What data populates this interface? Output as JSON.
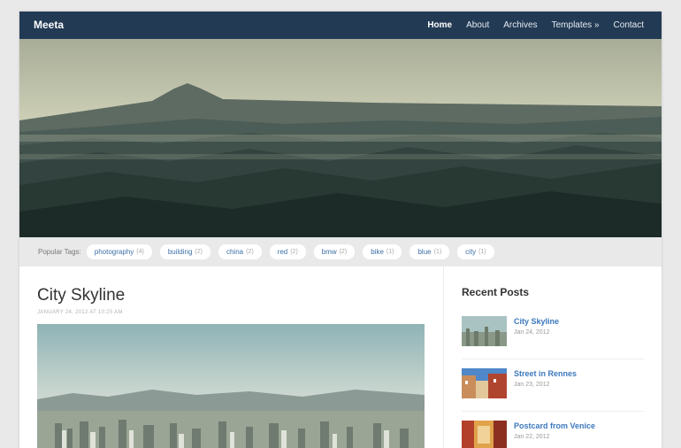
{
  "site": {
    "name": "Meeta"
  },
  "nav": [
    {
      "label": "Home",
      "active": true
    },
    {
      "label": "About"
    },
    {
      "label": "Archives"
    },
    {
      "label": "Templates »"
    },
    {
      "label": "Contact"
    }
  ],
  "tags": {
    "label": "Popular Tags:",
    "items": [
      {
        "name": "photography",
        "count": "(4)"
      },
      {
        "name": "building",
        "count": "(2)"
      },
      {
        "name": "china",
        "count": "(2)"
      },
      {
        "name": "red",
        "count": "(2)"
      },
      {
        "name": "bmw",
        "count": "(2)"
      },
      {
        "name": "bike",
        "count": "(1)"
      },
      {
        "name": "blue",
        "count": "(1)"
      },
      {
        "name": "city",
        "count": "(1)"
      }
    ]
  },
  "post": {
    "title": "City Skyline",
    "date": "JANUARY 24, 2012 AT 10:25 AM"
  },
  "sidebar": {
    "title": "Recent Posts",
    "items": [
      {
        "title": "City Skyline",
        "date": "Jan 24, 2012"
      },
      {
        "title": "Street in Rennes",
        "date": "Jan 23, 2012"
      },
      {
        "title": "Postcard from Venice",
        "date": "Jan 22, 2012"
      }
    ]
  },
  "colors": {
    "header": "#223a54",
    "link": "#3d79bd",
    "tag_text": "#3d6fa6"
  }
}
